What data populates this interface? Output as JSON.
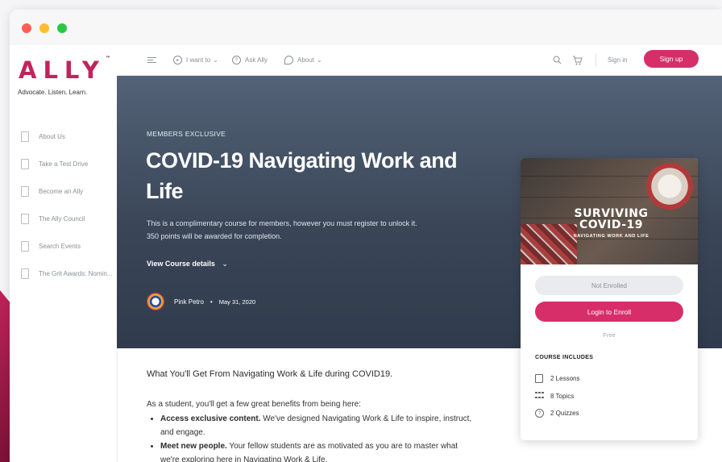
{
  "sidebar": {
    "logo": "ALLY",
    "trademark": "™",
    "tagline": "Advocate. Listen. Learn.",
    "items": [
      {
        "label": "About Us"
      },
      {
        "label": "Take a Test Drive"
      },
      {
        "label": "Become an Ally"
      },
      {
        "label": "The Ally Council"
      },
      {
        "label": "Search Events"
      },
      {
        "label": "The Grit Awards: Nomin..."
      }
    ]
  },
  "topnav": {
    "i_want_to": "I want to",
    "ask_ally": "Ask Ally",
    "about": "About",
    "sign_in": "Sign in",
    "sign_up": "Sign up"
  },
  "hero": {
    "eyebrow": "MEMBERS EXCLUSIVE",
    "title": "COVID-19 Navigating Work and Life",
    "desc_line1": "This is a complimentary course for members, however you must register to unlock it.",
    "desc_line2": "350 points will be awarded for completion.",
    "details_link": "View Course details",
    "author": "Pink Petro",
    "separator": "•",
    "date": "May 31, 2020"
  },
  "content": {
    "heading": "What You'll Get From Navigating Work & Life during COVID19.",
    "intro": "As a student, you'll get a few great benefits from being here:",
    "bullets": [
      {
        "bold": "Access exclusive content.",
        "text": " We've designed Navigating Work & Life to inspire, instruct, and engage."
      },
      {
        "bold": "Meet new people.",
        "text": " Your fellow students are as motivated as you are to master what we're exploring here in Navigating Work & Life."
      }
    ]
  },
  "card": {
    "image_title_line1": "SURVIVING",
    "image_title_line2": "COVID-19",
    "image_subtitle": "NAVIGATING WORK AND LIFE",
    "status": "Not Enrolled",
    "login_button": "Login to Enroll",
    "price": "Free",
    "includes_heading": "COURSE INCLUDES",
    "includes": [
      {
        "icon": "book-icon",
        "label": "2 Lessons"
      },
      {
        "icon": "topics-icon",
        "label": "8 Topics"
      },
      {
        "icon": "quiz-icon",
        "label": "2 Quizzes"
      }
    ]
  },
  "colors": {
    "accent": "#d72e6a",
    "hero_top": "#536277",
    "hero_bottom": "#303b4c"
  }
}
